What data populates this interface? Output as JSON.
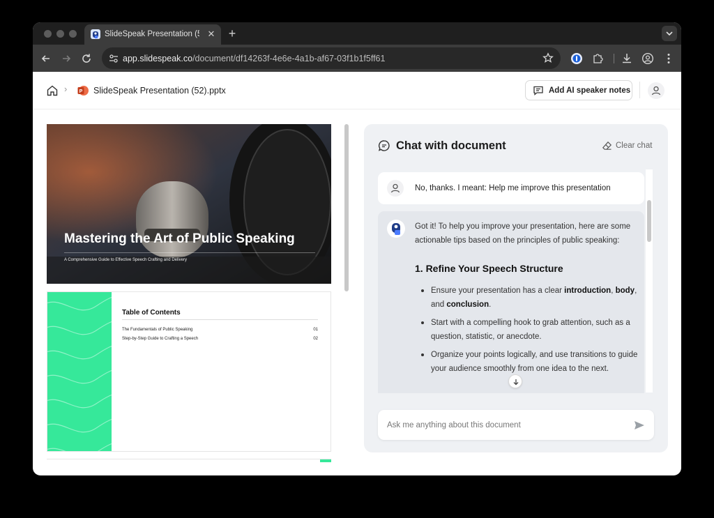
{
  "browser": {
    "tab_title": "SlideSpeak Presentation (52)",
    "tab_close": "✕",
    "new_tab": "+",
    "url_host": "app.slidespeak.co",
    "url_path": "/document/df14263f-4e6e-4a1b-af67-03f1b1f5ff61"
  },
  "header": {
    "breadcrumb_sep": "›",
    "filename": "SlideSpeak Presentation (52).pptx",
    "speaker_notes_label": "Add AI speaker notes"
  },
  "slides": {
    "slide1": {
      "title": "Mastering the Art of Public Speaking",
      "subtitle": "A Comprehensive Guide to Effective Speech Crafting and Delivery"
    },
    "slide2": {
      "title": "Table of Contents",
      "rows": [
        {
          "label": "The Fundamentals of Public Speaking",
          "num": "01"
        },
        {
          "label": "Step-by-Step Guide to Crafting a Speech",
          "num": "02"
        }
      ]
    }
  },
  "chat": {
    "title": "Chat with document",
    "clear_label": "Clear chat",
    "user_message": "No, thanks. I meant: Help me improve this presentation",
    "bot_intro": "Got it! To help you improve your presentation, here are some actionable tips based on the principles of public speaking:",
    "bot_heading": "1. Refine Your Speech Structure",
    "bullet1": {
      "a": "Ensure your presentation has a clear ",
      "b1": "introduction",
      "c": ", ",
      "b2": "body",
      "d": ", and ",
      "b3": "conclusion",
      "e": "."
    },
    "bullet2": "Start with a compelling hook to grab attention, such as a question, statistic, or anecdote.",
    "bullet3": "Organize your points logically, and use transitions to guide your audience smoothly from one idea to the next.",
    "input_placeholder": "Ask me anything about this document"
  },
  "colors": {
    "accent_green": "#36e89a",
    "chat_bg": "#eff1f4",
    "bot_bubble": "#e4e7ec"
  }
}
